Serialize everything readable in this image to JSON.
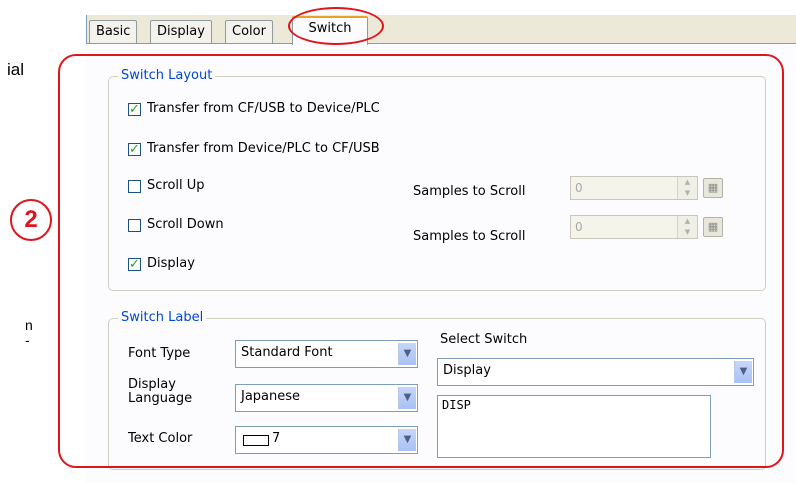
{
  "left_fragments": {
    "line1": "ial",
    "line2": "n",
    "line3": "-"
  },
  "callout": {
    "number": "2"
  },
  "tabs": [
    {
      "label": "Basic"
    },
    {
      "label": "Display"
    },
    {
      "label": "Color"
    },
    {
      "label": "Switch"
    }
  ],
  "switch_layout": {
    "legend": "Switch Layout",
    "checkboxes": [
      {
        "label": "Transfer from CF/USB to Device/PLC",
        "checked": true
      },
      {
        "label": "Transfer from Device/PLC to CF/USB",
        "checked": true
      },
      {
        "label": "Scroll Up",
        "checked": false
      },
      {
        "label": "Scroll Down",
        "checked": false
      },
      {
        "label": "Display",
        "checked": true
      }
    ],
    "scroll_up_samples": {
      "label": "Samples to Scroll",
      "value": "0"
    },
    "scroll_down_samples": {
      "label": "Samples to Scroll",
      "value": "0"
    }
  },
  "switch_label": {
    "legend": "Switch Label",
    "font_type": {
      "label": "Font Type",
      "value": "Standard Font"
    },
    "display_language": {
      "label_line1": "Display",
      "label_line2": "Language",
      "value": "Japanese"
    },
    "text_color": {
      "label": "Text Color",
      "value": "7"
    },
    "select_switch": {
      "label": "Select Switch",
      "value": "Display"
    },
    "switch_text": "DISP"
  },
  "icons": {
    "checkmark": "checkmark-icon",
    "dropdown": "chevron-down-icon",
    "spin_up": "spin-up-icon",
    "spin_down": "spin-down-icon",
    "keypad": "keypad-icon"
  },
  "colors": {
    "annotation_red": "#e0141b",
    "legend_blue": "#0046d5",
    "check_green": "#21a121",
    "active_tab_accent": "#e6a22b"
  }
}
